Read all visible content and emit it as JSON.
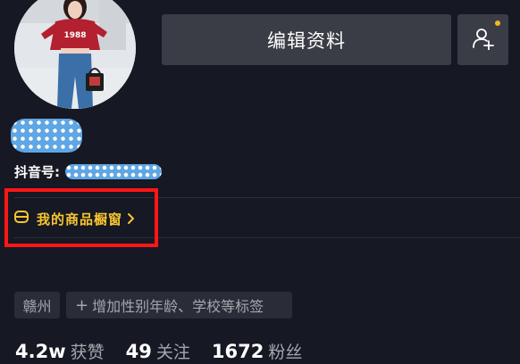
{
  "profile": {
    "edit_label": "编辑资料",
    "douyin_id_label": "抖音号:",
    "shop_label": "我的商品橱窗",
    "tags": {
      "city": "赣州",
      "add": "增加性别年龄、学校等标签"
    },
    "stats": [
      {
        "value": "4.2w",
        "label": "获赞"
      },
      {
        "value": "49",
        "label": "关注"
      },
      {
        "value": "1672",
        "label": "粉丝"
      }
    ],
    "avatar_print": "1988"
  },
  "icons": {
    "add_friend": "add-friend-icon",
    "shop": "shopping-bag-icon",
    "chevron": "chevron-right-icon"
  },
  "colors": {
    "background": "#161823",
    "button": "#3a3c46",
    "shop_accent": "#f7c531",
    "highlight_box": "#ff1616",
    "notification_dot": "#f2b625",
    "tag_bg": "#2a2c37",
    "muted_text": "#a6a7ad"
  }
}
